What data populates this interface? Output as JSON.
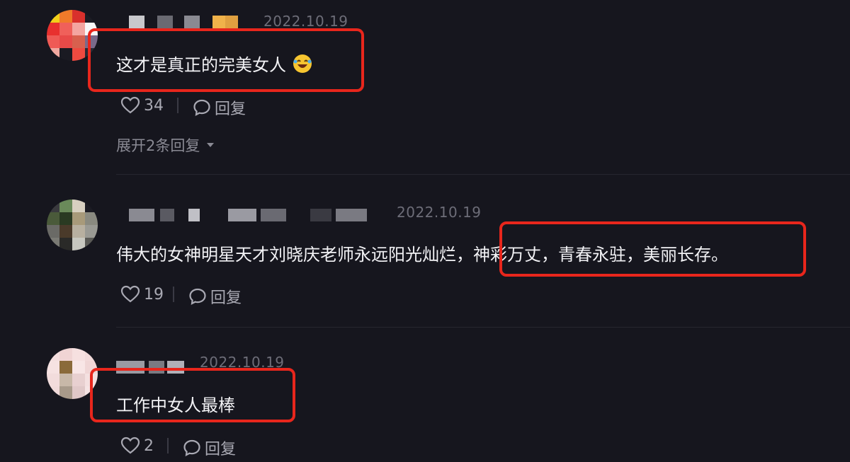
{
  "comments": [
    {
      "date": "2022.10.19",
      "text": "这才是真正的完美女人",
      "emoji": "rolling-on-floor-laughing-emoji",
      "likes": "34",
      "reply_label": "回复",
      "expand_label": "展开2条回复"
    },
    {
      "date": "2022.10.19",
      "text": "伟大的女神明星天才刘晓庆老师永远阳光灿烂，神彩万丈，青春永驻，美丽长存。",
      "likes": "19",
      "reply_label": "回复"
    },
    {
      "date": "2022.10.19",
      "text": "工作中女人最棒",
      "likes": "2",
      "reply_label": "回复"
    }
  ],
  "colors": {
    "background": "#16161e",
    "highlight_box": "#e8261c",
    "action_text": "#a9a9b3",
    "date_text": "#6d6d78"
  }
}
